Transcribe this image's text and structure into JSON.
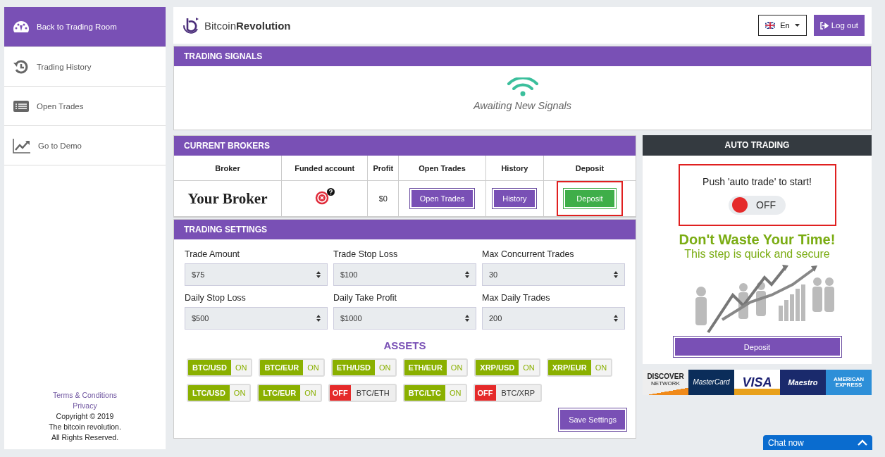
{
  "sidebar": {
    "items": [
      {
        "label": "Back to Trading Room",
        "kind": "gauge",
        "selected": true
      },
      {
        "label": "Trading History",
        "kind": "history",
        "selected": false
      },
      {
        "label": "Open Trades",
        "kind": "list",
        "selected": false
      },
      {
        "label": "Go to Demo",
        "kind": "chart",
        "selected": false
      }
    ],
    "footer_links": [
      "Terms & Conditions",
      "Privacy"
    ],
    "footer_lines": [
      "Copyright © 2019",
      "The bitcoin revolution.",
      "All Rights Reserved."
    ]
  },
  "header": {
    "logo": "Bitcoin**Revolution**",
    "language": "En",
    "logout": "Log out"
  },
  "signals": {
    "title": "TRADING SIGNALS",
    "status": "Awaiting New Signals"
  },
  "brokers": {
    "title": "CURRENT BROKERS",
    "columns": [
      "Broker",
      "Funded account",
      "Profit",
      "Open Trades",
      "History",
      "Deposit"
    ],
    "rows": [
      {
        "broker": "Your Broker",
        "funded": false,
        "profit": "$0",
        "open_trades": "Open Trades",
        "history": "History",
        "deposit": "Deposit"
      }
    ]
  },
  "settings": {
    "title": "TRADING SETTINGS",
    "fields": [
      {
        "label": "Trade Amount",
        "value": "$75"
      },
      {
        "label": "Trade Stop Loss",
        "value": "$100"
      },
      {
        "label": "Max Concurrent Trades",
        "value": "30"
      },
      {
        "label": "Daily Stop Loss",
        "value": "$500"
      },
      {
        "label": "Daily Take Profit",
        "value": "$1000"
      },
      {
        "label": "Max Daily Trades",
        "value": "200"
      }
    ],
    "assets_title": "ASSETS",
    "assets": [
      {
        "pair": "BTC/USD",
        "on": true,
        "state": "ON"
      },
      {
        "pair": "BTC/EUR",
        "on": true,
        "state": "ON"
      },
      {
        "pair": "ETH/USD",
        "on": true,
        "state": "ON"
      },
      {
        "pair": "ETH/EUR",
        "on": true,
        "state": "ON"
      },
      {
        "pair": "XRP/USD",
        "on": true,
        "state": "ON"
      },
      {
        "pair": "XRP/EUR",
        "on": true,
        "state": "ON"
      },
      {
        "pair": "LTC/USD",
        "on": true,
        "state": "ON"
      },
      {
        "pair": "LTC/EUR",
        "on": true,
        "state": "ON"
      },
      {
        "pair": "BTC/ETH",
        "on": false,
        "state": "OFF"
      },
      {
        "pair": "BTC/LTC",
        "on": true,
        "state": "ON"
      },
      {
        "pair": "BTC/XRP",
        "on": false,
        "state": "OFF"
      }
    ],
    "save": "Save Settings"
  },
  "auto_trading": {
    "title": "AUTO TRADING",
    "prompt": "Push 'auto trade' to start!",
    "on": false,
    "state": "OFF",
    "promo_headline": "Don't Waste Your Time!",
    "promo_subline": "This step is quick and secure",
    "deposit": "Deposit"
  },
  "payment_logos": [
    {
      "kind": "discover",
      "text": "DISCOVER",
      "subtext": "NETWORK"
    },
    {
      "kind": "mastercard",
      "text": "MasterCard"
    },
    {
      "kind": "visa",
      "text": "VISA"
    },
    {
      "kind": "maestro",
      "text": "Maestro"
    },
    {
      "kind": "amex",
      "text": "AMERICAN",
      "subtext": "EXPRESS"
    }
  ],
  "chat": {
    "label": "Chat now"
  }
}
